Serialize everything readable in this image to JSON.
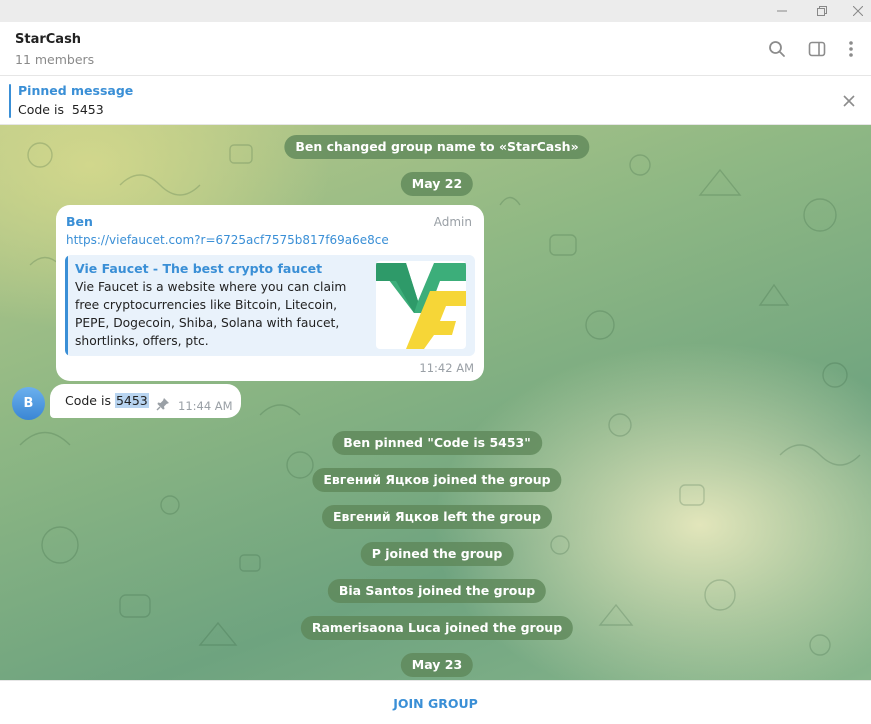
{
  "window": {
    "minimize_icon": "minimize-icon",
    "restore_icon": "restore-icon",
    "close_icon": "close-icon"
  },
  "header": {
    "title": "StarCash",
    "subtitle": "11 members",
    "icons": [
      "search-icon",
      "sidebar-toggle-icon",
      "more-vertical-icon"
    ]
  },
  "pinned": {
    "title": "Pinned message",
    "text": "Code is  5453"
  },
  "chat": {
    "service_top": "Ben changed group name to «StarCash»",
    "date1": "May 22",
    "message1": {
      "sender": "Ben",
      "role": "Admin",
      "link": "https://viefaucet.com?r=6725acf7575b817f69a6e8ce",
      "preview_title": "Vie Faucet - The best crypto faucet",
      "preview_desc": "Vie Faucet is a website where you can claim free cryptocurrencies like Bitcoin, Litecoin, PEPE, Dogecoin, Shiba, Solana with faucet, shortlinks, offers, ptc.",
      "time": "11:42 AM"
    },
    "message2": {
      "avatar_letter": "B",
      "text_prefix": "Code is ",
      "text_highlight": "5453",
      "time": "11:44 AM"
    },
    "events": [
      "Ben pinned \"Code is  5453\"",
      "Евгений Яцков joined the group",
      "Евгений Яцков left the group",
      "P joined the group",
      "Bia Santos joined the group",
      "Ramerisaona Luca joined the group"
    ],
    "date2": "May 23"
  },
  "footer": {
    "join_label": "JOIN GROUP"
  },
  "colors": {
    "accent": "#3a8fd6",
    "service_bg": "#5d8658",
    "avatar": "#4a95df"
  }
}
